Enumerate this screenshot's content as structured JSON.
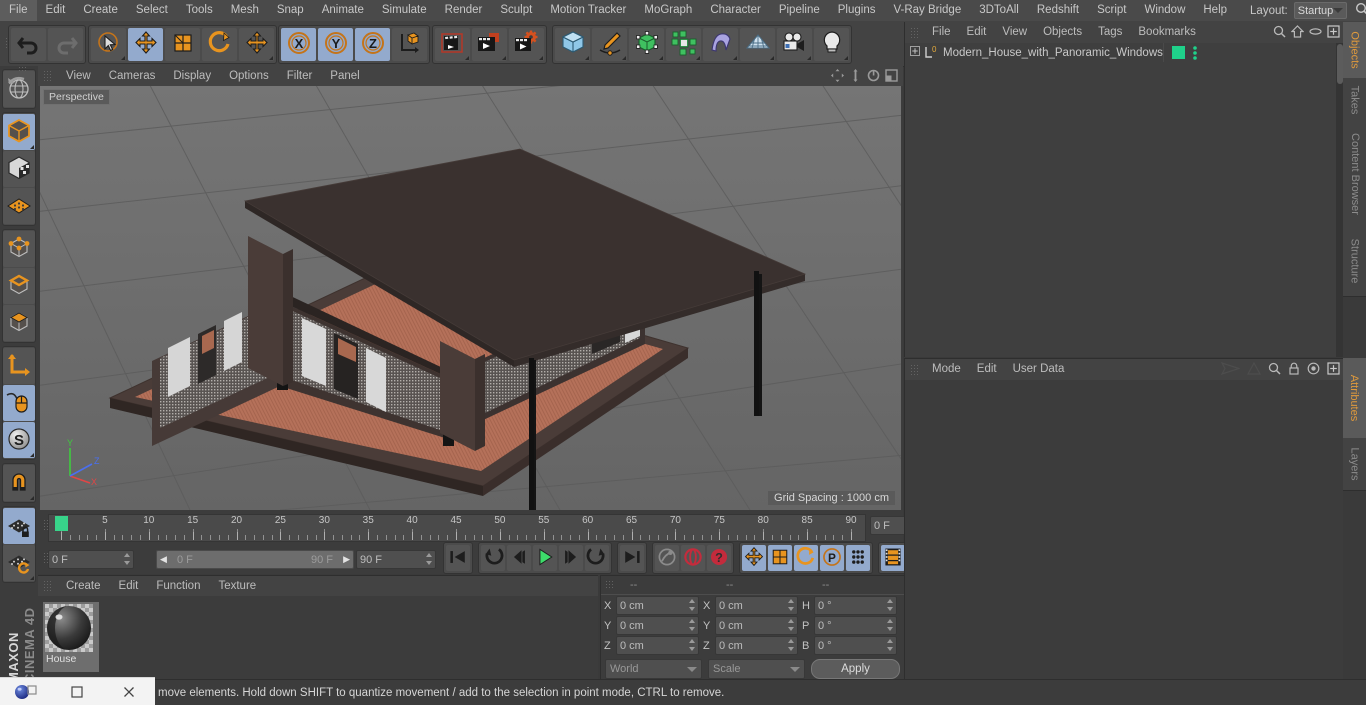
{
  "app": {
    "brand_line1": "MAXON",
    "brand_line2": "CINEMA 4D"
  },
  "menubar": {
    "items": [
      "File",
      "Edit",
      "Create",
      "Select",
      "Tools",
      "Mesh",
      "Snap",
      "Animate",
      "Simulate",
      "Render",
      "Sculpt",
      "Motion Tracker",
      "MoGraph",
      "Character",
      "Pipeline",
      "Plugins",
      "V-Ray Bridge",
      "3DToAll",
      "Redshift",
      "Script",
      "Window",
      "Help"
    ],
    "layout_label": "Layout:",
    "layout_value": "Startup",
    "search_icon": "magnifier-icon"
  },
  "toolbar": {
    "groups": [
      {
        "name": "history",
        "buttons": [
          {
            "icon": "undo-icon",
            "label": "Undo",
            "selected": false,
            "corner": false
          },
          {
            "icon": "redo-icon",
            "label": "Redo",
            "selected": false,
            "corner": false
          }
        ]
      },
      {
        "name": "tools",
        "buttons": [
          {
            "icon": "live-selection-icon",
            "label": "Live Selection",
            "selected": false,
            "corner": true
          },
          {
            "icon": "move-icon",
            "label": "Move",
            "selected": true,
            "corner": false
          },
          {
            "icon": "scale-icon",
            "label": "Scale",
            "selected": false,
            "corner": false
          },
          {
            "icon": "rotate-icon",
            "label": "Rotate",
            "selected": false,
            "corner": false
          },
          {
            "icon": "move-alt-icon",
            "label": "Move Tool",
            "selected": false,
            "corner": true
          }
        ]
      },
      {
        "name": "axis-locks",
        "buttons": [
          {
            "icon": "x-axis-icon",
            "label": "X Axis",
            "selected": true,
            "corner": false
          },
          {
            "icon": "y-axis-icon",
            "label": "Y Axis",
            "selected": true,
            "corner": false
          },
          {
            "icon": "z-axis-icon",
            "label": "Z Axis",
            "selected": true,
            "corner": false
          },
          {
            "icon": "world-object-coord-icon",
            "label": "World / Object Coordinate System",
            "selected": false,
            "corner": false
          }
        ]
      },
      {
        "name": "render",
        "buttons": [
          {
            "icon": "render-view-icon",
            "label": "Render View",
            "selected": false,
            "corner": true
          },
          {
            "icon": "render-picture-viewer-icon",
            "label": "Render to Picture Viewer",
            "selected": false,
            "corner": true
          },
          {
            "icon": "render-settings-icon",
            "label": "Edit Render Settings",
            "selected": false,
            "corner": true
          }
        ]
      },
      {
        "name": "objects",
        "buttons": [
          {
            "icon": "cube-primitive-icon",
            "label": "Add Cube Object",
            "selected": false,
            "corner": true
          },
          {
            "icon": "spline-pen-icon",
            "label": "Add Spline Object",
            "selected": false,
            "corner": true
          },
          {
            "icon": "nurbs-generator-icon",
            "label": "Add Generator Object",
            "selected": false,
            "corner": true
          },
          {
            "icon": "mograph-array-icon",
            "label": "Add Array Object",
            "selected": false,
            "corner": true
          },
          {
            "icon": "deformer-bend-icon",
            "label": "Add Bend Object",
            "selected": false,
            "corner": true
          },
          {
            "icon": "environment-floor-icon",
            "label": "Add Scene Object",
            "selected": false,
            "corner": true
          },
          {
            "icon": "camera-icon",
            "label": "Add Camera Object",
            "selected": false,
            "corner": true
          },
          {
            "icon": "light-bulb-icon",
            "label": "Add Light Object",
            "selected": false,
            "corner": true
          }
        ]
      }
    ]
  },
  "left_toolbar": {
    "groups": [
      {
        "buttons": [
          {
            "icon": "globe-undo-icon",
            "label": "Undo View",
            "selected": false,
            "corner": false
          }
        ]
      },
      {
        "buttons": [
          {
            "icon": "model-mode-icon",
            "label": "Model Mode",
            "selected": true,
            "corner": true
          },
          {
            "icon": "texture-mode-icon",
            "label": "Texture Mode",
            "selected": false,
            "corner": false
          },
          {
            "icon": "workplane-mode-icon",
            "label": "Workplane Mode",
            "selected": false,
            "corner": false
          }
        ]
      },
      {
        "buttons": [
          {
            "icon": "points-mode-icon",
            "label": "Points Mode",
            "selected": false,
            "corner": false
          },
          {
            "icon": "edges-mode-icon",
            "label": "Edges Mode",
            "selected": false,
            "corner": false
          },
          {
            "icon": "polygons-mode-icon",
            "label": "Polygons Mode",
            "selected": false,
            "corner": false
          }
        ]
      },
      {
        "buttons": [
          {
            "icon": "axis-modify-icon",
            "label": "Enable Axis Modification",
            "selected": false,
            "corner": false
          },
          {
            "icon": "viewport-solo-mouse-icon",
            "label": "Enable/Disable Tool",
            "selected": true,
            "corner": false
          },
          {
            "icon": "soft-selection-icon",
            "label": "Soft Selection",
            "selected": true,
            "corner": true
          }
        ]
      },
      {
        "buttons": [
          {
            "icon": "magnet-icon",
            "label": "Magnet Tool",
            "selected": false,
            "corner": true
          }
        ]
      },
      {
        "buttons": [
          {
            "icon": "lock-workplane-icon",
            "label": "Lock Workplane",
            "selected": true,
            "corner": false
          },
          {
            "icon": "planar-workplane-icon",
            "label": "Planar Workplane",
            "selected": false,
            "corner": true
          }
        ]
      }
    ]
  },
  "viewport": {
    "menu": [
      "View",
      "Cameras",
      "Display",
      "Options",
      "Filter",
      "Panel"
    ],
    "view_label": "Perspective",
    "grid_label": "Grid Spacing : 1000 cm",
    "corner_icons": [
      "pan-icon",
      "zoom-icon",
      "rotate-icon",
      "maximize-icon"
    ],
    "axis_gizmo": {
      "x": "X",
      "y": "Y",
      "z": "Z",
      "x_color": "#e04646",
      "y_color": "#3fcb3f",
      "z_color": "#4a6ff0"
    },
    "scene_colors": {
      "background": "#6e6e6e",
      "grid_line": "#5d5d5d",
      "roof": "#3a312f",
      "wall_dark": "#4a3c38",
      "deck_wood": "#b5715a",
      "window_frame": "#d8d8d8",
      "glass": "#5f5a58",
      "column": "#1c1c1c"
    }
  },
  "timeline": {
    "ticks": [
      "0",
      "5",
      "10",
      "15",
      "20",
      "25",
      "30",
      "35",
      "40",
      "45",
      "50",
      "55",
      "60",
      "65",
      "70",
      "75",
      "80",
      "85",
      "90"
    ],
    "current_frame_field": "0 F",
    "start_field": "0 F",
    "range_start": "0 F",
    "range_end": "90 F",
    "end_field": "90 F",
    "preview_field": "0 F",
    "playhead_frame": 0,
    "buttons": [
      {
        "icon": "go-to-start-icon",
        "label": "Go to Start",
        "selected": false
      },
      {
        "icon": "previous-key-icon",
        "label": "Go to Previous Key",
        "selected": false
      },
      {
        "icon": "previous-frame-icon",
        "label": "Go to Previous Frame",
        "selected": false
      },
      {
        "icon": "play-forwards-icon",
        "label": "Play Forwards",
        "selected": false
      },
      {
        "icon": "next-frame-icon",
        "label": "Go to Next Frame",
        "selected": false
      },
      {
        "icon": "next-key-icon",
        "label": "Go to Next Key",
        "selected": false
      },
      {
        "icon": "go-to-end-icon",
        "label": "Go to End",
        "selected": false
      },
      {
        "icon": "record-active-objects-icon",
        "label": "Record Active Objects",
        "selected": false
      },
      {
        "icon": "autokeying-icon",
        "label": "Autokeying",
        "selected": false
      },
      {
        "icon": "keyframe-selection-icon",
        "label": "Keyframe Selection",
        "selected": false
      },
      {
        "icon": "position-key-icon",
        "label": "Position",
        "selected": true
      },
      {
        "icon": "scale-key-icon",
        "label": "Scale",
        "selected": true
      },
      {
        "icon": "rotation-key-icon",
        "label": "Rotation",
        "selected": true
      },
      {
        "icon": "param-key-icon",
        "label": "Parameter",
        "selected": true
      },
      {
        "icon": "pla-key-icon",
        "label": "Point Level Animation",
        "selected": true
      },
      {
        "icon": "timeline-strip-icon",
        "label": "Timeline",
        "selected": true
      }
    ]
  },
  "material_manager": {
    "menu": [
      "Create",
      "Edit",
      "Function",
      "Texture"
    ],
    "materials": [
      {
        "name": "House",
        "selected": true
      }
    ]
  },
  "coordinates": {
    "col_headers": [
      "--",
      "--",
      "--"
    ],
    "rows": [
      {
        "label1": "X",
        "value1": "0 cm",
        "label2": "X",
        "value2": "0 cm",
        "label3": "H",
        "value3": "0 °"
      },
      {
        "label1": "Y",
        "value1": "0 cm",
        "label2": "Y",
        "value2": "0 cm",
        "label3": "P",
        "value3": "0 °"
      },
      {
        "label1": "Z",
        "value1": "0 cm",
        "label2": "Z",
        "value2": "0 cm",
        "label3": "B",
        "value3": "0 °"
      }
    ],
    "system_value": "World",
    "size_value": "Scale",
    "apply_label": "Apply"
  },
  "object_manager": {
    "menu": [
      "File",
      "Edit",
      "View",
      "Objects",
      "Tags",
      "Bookmarks"
    ],
    "header_icons": [
      "magnifier-icon",
      "home-icon",
      "ellipse-icon",
      "plus-box-icon"
    ],
    "objects": [
      {
        "name": "Modern_House_with_Panoramic_Windows",
        "level_badge": "0",
        "tag_color": "#1fd18a",
        "expandable": true
      }
    ]
  },
  "attribute_manager": {
    "menu": [
      "Mode",
      "Edit",
      "User Data"
    ],
    "header_icons": [
      "animate-left-icon",
      "animate-right-icon",
      "magnifier-icon",
      "lock-icon",
      "target-icon",
      "plus-box-icon"
    ]
  },
  "vertical_tabs": {
    "top": [
      {
        "label": "Objects",
        "active": true
      },
      {
        "label": "Takes",
        "active": false
      },
      {
        "label": "Content Browser",
        "active": false
      },
      {
        "label": "Structure",
        "active": false
      }
    ],
    "bottom": [
      {
        "label": "Attributes",
        "active": true
      },
      {
        "label": "Layers",
        "active": false
      }
    ]
  },
  "status_bar": {
    "text": "move elements. Hold down SHIFT to quantize movement / add to the selection in point mode, CTRL to remove."
  },
  "taskbar": {
    "items": [
      {
        "icon": "cinema4d-app-icon",
        "label": "Cinema 4D"
      },
      {
        "icon": "restore-window-icon",
        "label": "Restore"
      },
      {
        "icon": "close-window-icon",
        "label": "Close"
      }
    ]
  }
}
